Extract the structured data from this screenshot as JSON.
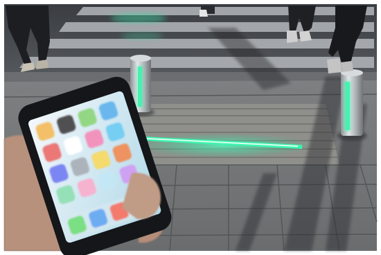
{
  "scene": {
    "colors": {
      "border": "#ffffff",
      "road": "#4a4d52",
      "road_dark": "#2e3034",
      "crosswalk_stripe": "#b8bcc0",
      "pavement": "#8c8e8f",
      "pavement_dark": "#5c5e60",
      "tactile_paving": "#9a9a96",
      "led_green": "#35f0a8",
      "led_glow": "#1ed991",
      "bollard_metal": "#c9cdd0",
      "phone_body": "#17191c",
      "phone_screen": "#d8eef6",
      "hand_skin": "#c9a58f",
      "shadow": "#2a2b2e"
    },
    "icons": [
      "photos-app-icon",
      "clock-app-icon",
      "maps-app-icon",
      "weather-app-icon",
      "settings-app-icon",
      "messages-app-icon"
    ]
  }
}
